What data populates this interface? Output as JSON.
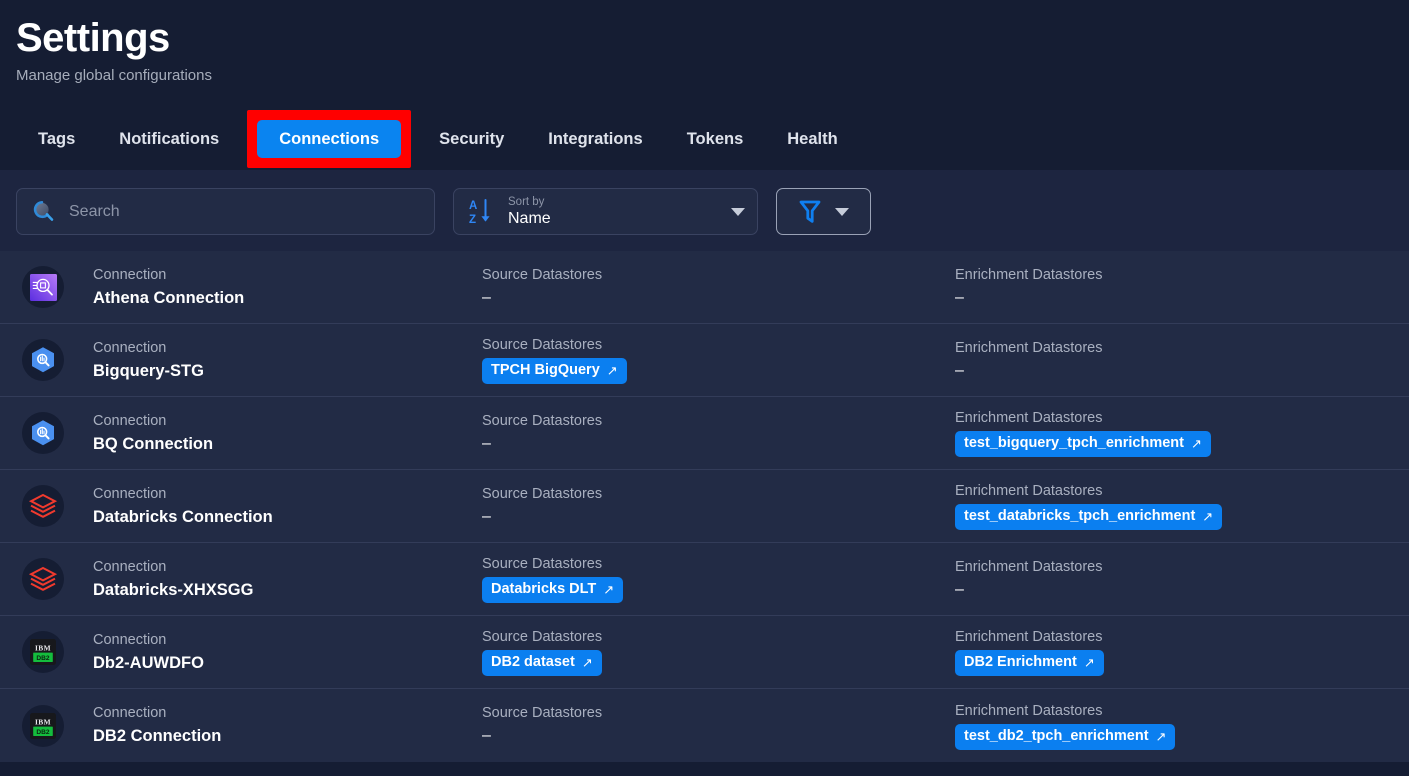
{
  "header": {
    "title": "Settings",
    "subtitle": "Manage global configurations"
  },
  "tabs": [
    {
      "label": "Tags",
      "selected": false
    },
    {
      "label": "Notifications",
      "selected": false
    },
    {
      "label": "Connections",
      "selected": true,
      "highlighted": true
    },
    {
      "label": "Security",
      "selected": false
    },
    {
      "label": "Integrations",
      "selected": false
    },
    {
      "label": "Tokens",
      "selected": false
    },
    {
      "label": "Health",
      "selected": false
    }
  ],
  "toolbar": {
    "search": {
      "value": "",
      "placeholder": "Search",
      "icon": "search-icon"
    },
    "sort": {
      "caption": "Sort by",
      "value": "Name",
      "icon": "sort-az-icon"
    },
    "filter": {
      "icon": "filter-icon"
    }
  },
  "labels": {
    "connection": "Connection",
    "source_datastores": "Source Datastores",
    "enrichment_datastores": "Enrichment Datastores",
    "empty": "–",
    "external_link": "↗"
  },
  "colors": {
    "page_bg": "#151d33",
    "card_bg": "#222b45",
    "toolbar_bg": "#1d2540",
    "accent_blue": "#0a84f0",
    "chip_blue": "#0b7ff0",
    "highlight_red": "#ff0000",
    "divider": "#333c59",
    "muted_text": "#a9b0c0"
  },
  "rows": [
    {
      "icon": "athena-icon",
      "type": "Connection",
      "name": "Athena Connection",
      "source_label": "Source Datastores",
      "source": [],
      "source_empty": "–",
      "enrichment_label": "Enrichment Datastores",
      "enrichment": [],
      "enrichment_empty": "–"
    },
    {
      "icon": "bigquery-icon",
      "type": "Connection",
      "name": "Bigquery-STG",
      "source_label": "Source Datastores",
      "source": [
        "TPCH BigQuery"
      ],
      "source_empty": "–",
      "enrichment_label": "Enrichment Datastores",
      "enrichment": [],
      "enrichment_empty": "–"
    },
    {
      "icon": "bigquery-icon",
      "type": "Connection",
      "name": "BQ Connection",
      "source_label": "Source Datastores",
      "source": [],
      "source_empty": "–",
      "enrichment_label": "Enrichment Datastores",
      "enrichment": [
        "test_bigquery_tpch_enrichment"
      ],
      "enrichment_empty": "–"
    },
    {
      "icon": "databricks-icon",
      "type": "Connection",
      "name": "Databricks Connection",
      "source_label": "Source Datastores",
      "source": [],
      "source_empty": "–",
      "enrichment_label": "Enrichment Datastores",
      "enrichment": [
        "test_databricks_tpch_enrichment"
      ],
      "enrichment_empty": "–"
    },
    {
      "icon": "databricks-icon",
      "type": "Connection",
      "name": "Databricks-XHXSGG",
      "source_label": "Source Datastores",
      "source": [
        "Databricks DLT"
      ],
      "source_empty": "–",
      "enrichment_label": "Enrichment Datastores",
      "enrichment": [],
      "enrichment_empty": "–"
    },
    {
      "icon": "db2-icon",
      "type": "Connection",
      "name": "Db2-AUWDFO",
      "source_label": "Source Datastores",
      "source": [
        "DB2 dataset"
      ],
      "source_empty": "–",
      "enrichment_label": "Enrichment Datastores",
      "enrichment": [
        "DB2 Enrichment"
      ],
      "enrichment_empty": "–"
    },
    {
      "icon": "db2-icon",
      "type": "Connection",
      "name": "DB2 Connection",
      "source_label": "Source Datastores",
      "source": [],
      "source_empty": "–",
      "enrichment_label": "Enrichment Datastores",
      "enrichment": [
        "test_db2_tpch_enrichment"
      ],
      "enrichment_empty": "–"
    }
  ]
}
